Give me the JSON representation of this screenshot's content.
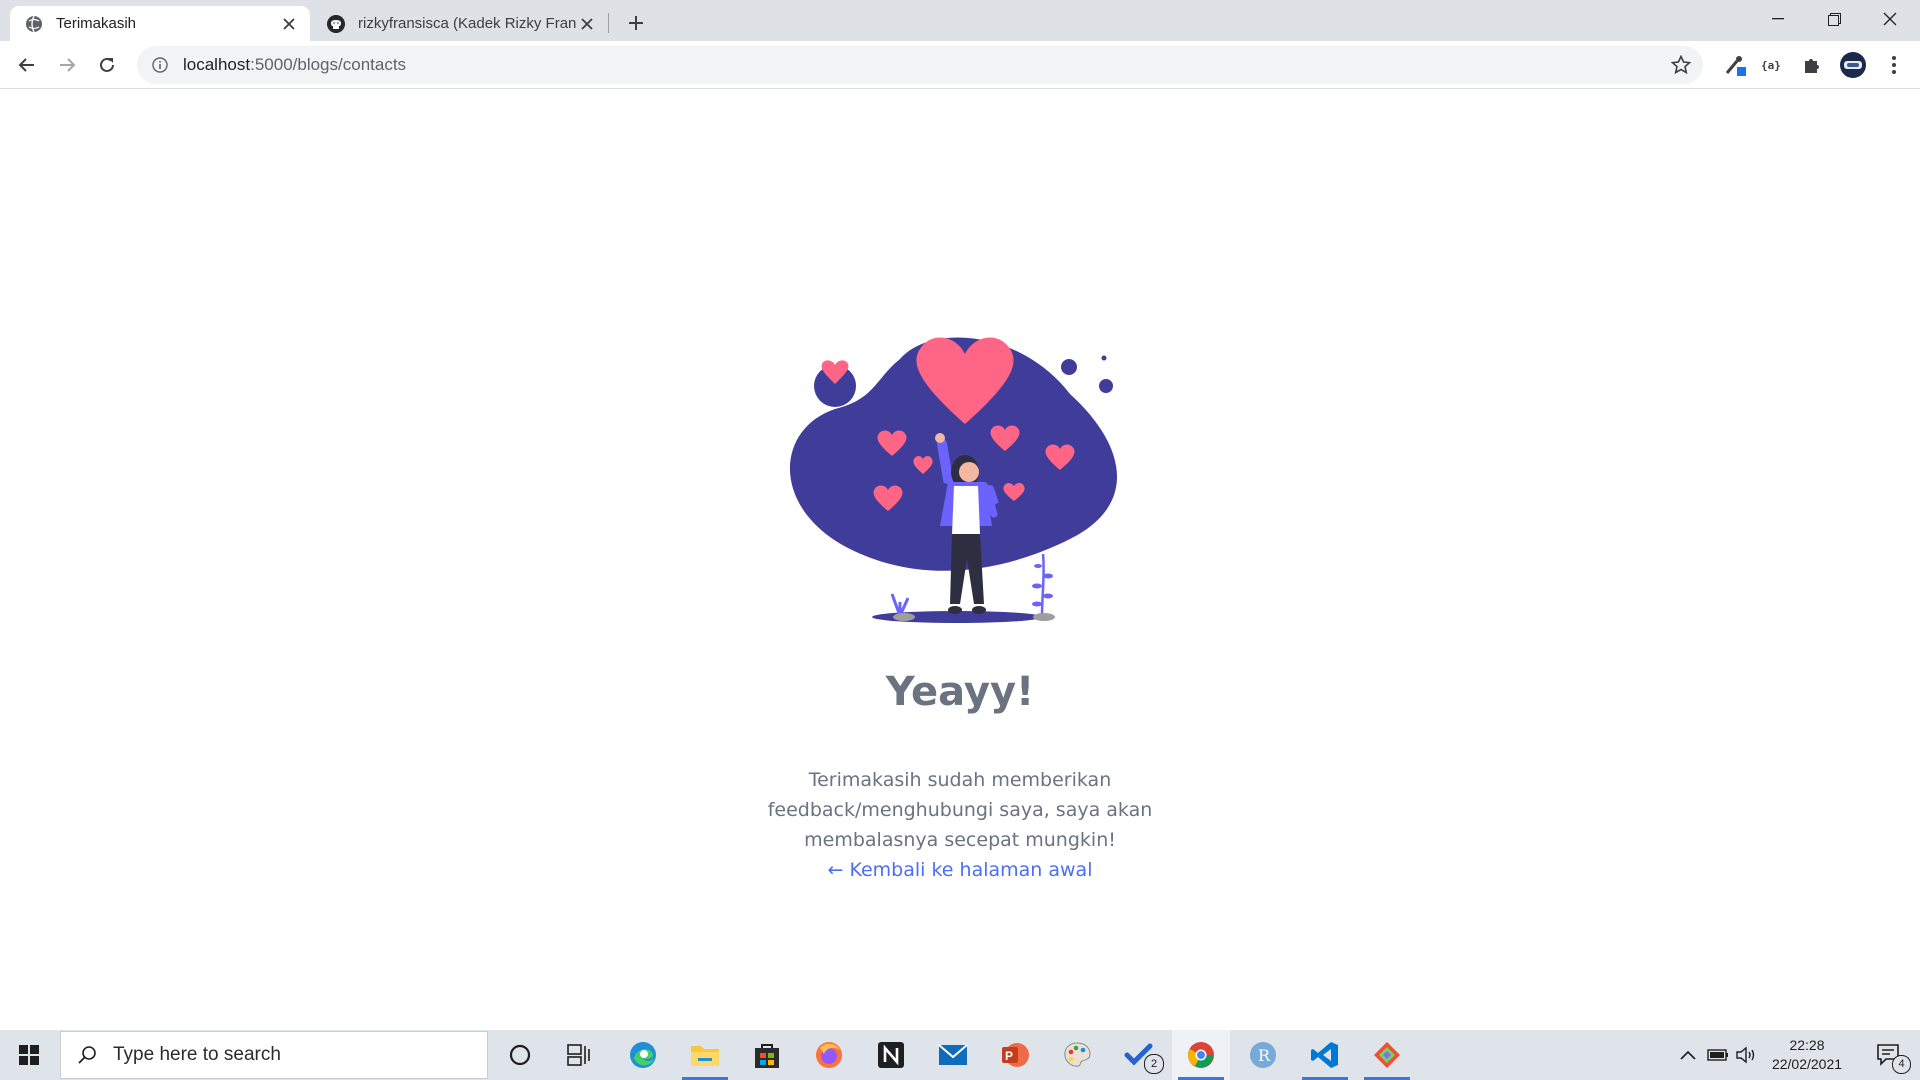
{
  "browser": {
    "tabs": [
      {
        "title": "Terimakasih",
        "active": true
      },
      {
        "title": "rizkyfransisca (Kadek Rizky Fransi",
        "active": false
      }
    ],
    "address": {
      "host": "localhost",
      "path": ":5000/blogs/contacts"
    }
  },
  "page": {
    "headline": "Yeayy!",
    "message": "Terimakasih sudah memberikan feedback/menghubungi saya, saya akan membalasnya secepat mungkin!",
    "back_link": "← Kembali ke halaman awal",
    "illustration": {
      "icon": "woman-with-hearts-illustration",
      "blob_color": "#3f3d99",
      "heart_color": "#ff6584",
      "sleeve_color": "#6c63ff"
    }
  },
  "taskbar": {
    "search_placeholder": "Type here to search",
    "apps": [
      "cortana",
      "task-view",
      "edge",
      "file-explorer",
      "store",
      "firefox",
      "notion",
      "mail",
      "powerpoint",
      "paint",
      "todo",
      "chrome",
      "r",
      "vscode",
      "gitkraken"
    ],
    "todo_badge": "2",
    "time": "22:28",
    "date": "22/02/2021",
    "notification_count": "4"
  },
  "colors": {
    "accent": "#4c6ef5",
    "text_muted": "#6b7280",
    "taskbar_bg": "#dfe3ea",
    "tabbar_bg": "#dee1e6"
  }
}
